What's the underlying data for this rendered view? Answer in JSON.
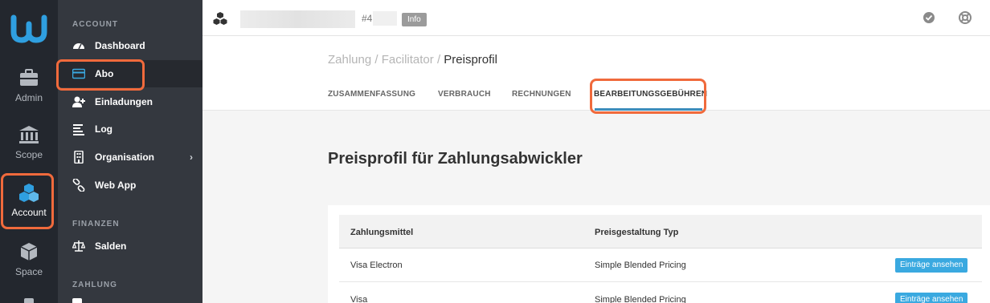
{
  "rail": {
    "items": [
      {
        "label": "Admin"
      },
      {
        "label": "Scope"
      },
      {
        "label": "Account"
      },
      {
        "label": "Space"
      }
    ]
  },
  "sidebar": {
    "section_account": "ACCOUNT",
    "section_finanzen": "FINANZEN",
    "section_zahlung": "ZAHLUNG",
    "items": [
      {
        "label": "Dashboard"
      },
      {
        "label": "Abo"
      },
      {
        "label": "Einladungen"
      },
      {
        "label": "Log"
      },
      {
        "label": "Organisation"
      },
      {
        "label": "Web App"
      },
      {
        "label": "Salden"
      }
    ],
    "chevron": "›"
  },
  "topbar": {
    "hash": "#4",
    "badge": "Info"
  },
  "header": {
    "breadcrumb_1": "Zahlung",
    "breadcrumb_sep": "/",
    "breadcrumb_2": "Facilitator",
    "breadcrumb_current": "Preisprofil",
    "tabs": [
      {
        "label": "ZUSAMMENFASSUNG"
      },
      {
        "label": "VERBRAUCH"
      },
      {
        "label": "RECHNUNGEN"
      },
      {
        "label": "BEARBEITUNGSGEBÜHREN"
      }
    ]
  },
  "main": {
    "title": "Preisprofil für Zahlungsabwickler",
    "table": {
      "columns": [
        "Zahlungsmittel",
        "Preisgestaltung Typ"
      ],
      "rows": [
        {
          "zahlungsmittel": "Visa Electron",
          "typ": "Simple Blended Pricing",
          "action": "Einträge ansehen"
        },
        {
          "zahlungsmittel": "Visa",
          "typ": "Simple Blended Pricing",
          "action": "Einträge ansehen"
        }
      ]
    }
  },
  "colors": {
    "accent": "#3c8dbc",
    "highlight": "#f06a3c",
    "logo": "#2f9fe0",
    "button": "#3aa9e0"
  }
}
